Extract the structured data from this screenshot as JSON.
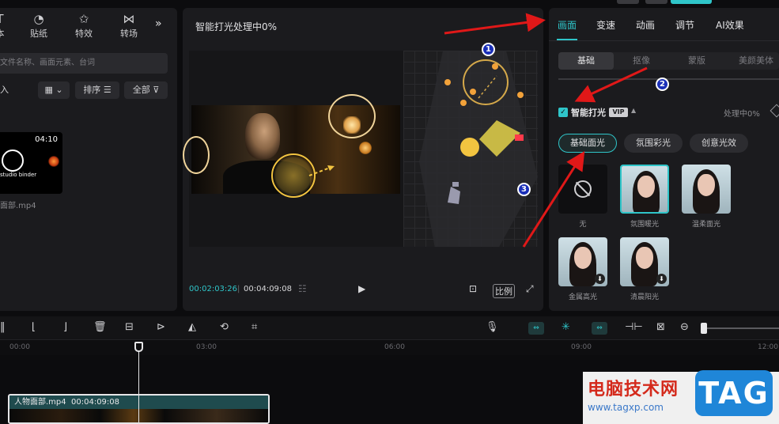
{
  "colors": {
    "accent": "#2fc5c9",
    "annotation": "#e01818",
    "badge": "#1a2fb8"
  },
  "left_panel": {
    "categories": [
      {
        "label": "本",
        "icon": "text-icon"
      },
      {
        "label": "贴纸",
        "icon": "sticker-icon"
      },
      {
        "label": "特效",
        "icon": "effects-icon"
      },
      {
        "label": "转场",
        "icon": "transition-icon"
      }
    ],
    "search_placeholder": "文件名称、画面元素、台词",
    "import_label": "入",
    "sort_label": "排序",
    "filter_label": "全部",
    "media": {
      "duration": "04:10",
      "brand": "studio binder",
      "filename": "面部.mp4"
    }
  },
  "player": {
    "title": "智能打光处理中0%",
    "current_time": "00:02:03:26",
    "total_time": "00:04:09:08",
    "ratio_label": "比例"
  },
  "right_panel": {
    "tabs": [
      "画面",
      "变速",
      "动画",
      "调节",
      "AI效果"
    ],
    "subtabs": [
      "基础",
      "抠像",
      "蒙版",
      "美颜美体"
    ],
    "smart_light_label": "智能打光",
    "vip_label": "VIP",
    "processing_label": "处理中0%",
    "pills": [
      "基础面光",
      "氛围彩光",
      "创意光效"
    ],
    "presets": [
      {
        "label": "无"
      },
      {
        "label": "氛围暖光"
      },
      {
        "label": "温柔面光"
      },
      {
        "label": "金属高光"
      },
      {
        "label": "清晨阳光"
      }
    ]
  },
  "timeline": {
    "ticks": [
      "00:00",
      "03:00",
      "06:00",
      "09:00",
      "12:00"
    ],
    "clip_name": "人物面部.mp4",
    "clip_duration": "00:04:09:08"
  },
  "watermark": {
    "title": "电脑技术网",
    "url": "www.tagxp.com",
    "tag": "TAG"
  },
  "annotations": {
    "badges": [
      "1",
      "2",
      "3"
    ]
  }
}
